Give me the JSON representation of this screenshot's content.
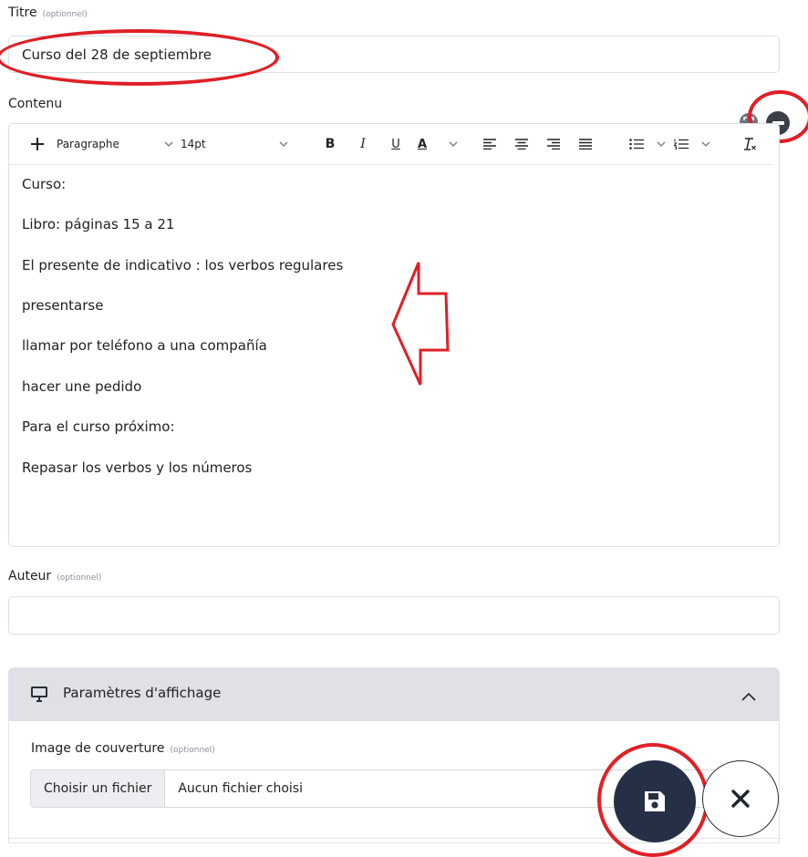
{
  "titre": {
    "label": "Titre",
    "optional": "(optionnel)",
    "value": "Curso del 28 de septiembre"
  },
  "contenu": {
    "label": "Contenu",
    "toolbar": {
      "insert": "+",
      "block_format": "Paragraphe",
      "font_size": "14pt",
      "bold": "B",
      "italic": "I",
      "underline": "U",
      "text_color": "A"
    },
    "paragraphs": [
      "Curso:",
      "Libro: páginas 15 a 21",
      "El presente de indicativo : los verbos regulares",
      "presentarse",
      "llamar por teléfono a una compañía",
      "hacer une pedido",
      "Para el curso próximo:",
      "Repasar los verbos y los números"
    ]
  },
  "auteur": {
    "label": "Auteur",
    "optional": "(optionnel)",
    "value": ""
  },
  "display_panel": {
    "title": "Paramètres d'affichage",
    "cover": {
      "label": "Image de couverture",
      "optional": "(optionnel)",
      "button": "Choisir un fichier",
      "status": "Aucun fichier choisi"
    }
  },
  "colors": {
    "annotation_red": "#e01f26",
    "save_fab": "#253046",
    "panel_header": "#dfe1e6"
  },
  "icons": [
    "plus-icon",
    "chevron-down-icon",
    "align-left-icon",
    "align-center-icon",
    "align-right-icon",
    "align-justify-icon",
    "bullet-list-icon",
    "numbered-list-icon",
    "clear-format-icon",
    "fullscreen-icon",
    "remove-icon",
    "monitor-icon",
    "chevron-up-icon",
    "save-icon",
    "close-icon",
    "arrow-left-icon"
  ]
}
